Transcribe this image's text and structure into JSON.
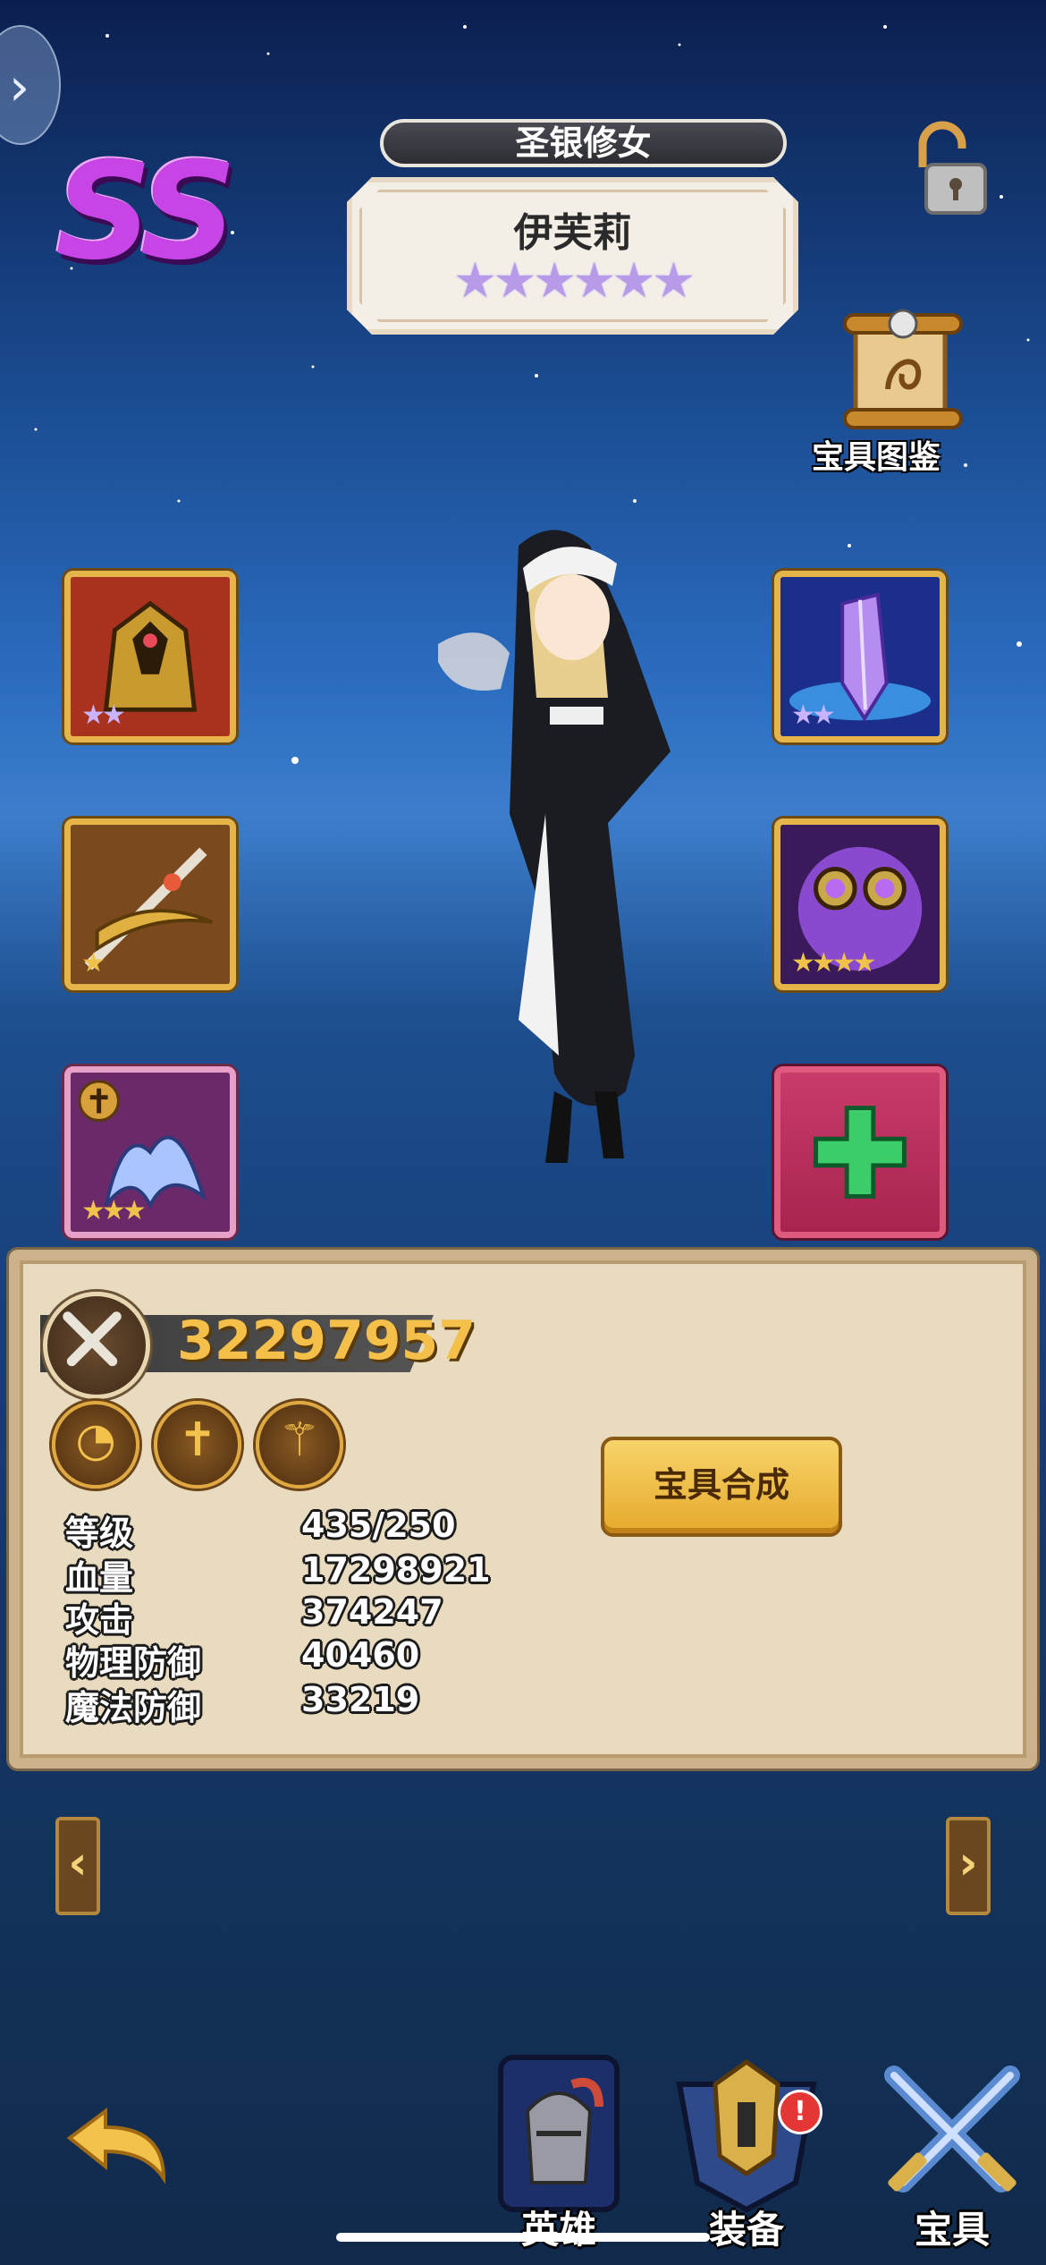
{
  "hero": {
    "grade": "SS",
    "class_title": "圣银修女",
    "name": "伊芙莉",
    "stars": "★★★★★★"
  },
  "artifact_codex": {
    "label": "宝具图鉴",
    "icon": "scroll-icon"
  },
  "lock": {
    "icon": "unlocked-padlock-icon"
  },
  "equipment": {
    "left": [
      {
        "name": "golden-armor",
        "stars": "★★"
      },
      {
        "name": "golden-sword",
        "stars": "★"
      },
      {
        "name": "holy-splash-relic",
        "stars": "★★★"
      }
    ],
    "right": [
      {
        "name": "purple-crystal",
        "stars": "★★"
      },
      {
        "name": "purple-orb-goggles",
        "stars": "★★★★"
      },
      {
        "name": "add-slot",
        "stars": ""
      }
    ]
  },
  "panel": {
    "power": "32297957",
    "skills": [
      "swirl-skill-icon",
      "cross-skill-icon",
      "staff-skill-icon"
    ],
    "synthesize_label": "宝具合成",
    "stats": [
      {
        "label": "等级",
        "value": "435/250"
      },
      {
        "label": "血量",
        "value": "17298921"
      },
      {
        "label": "攻击",
        "value": "374247"
      },
      {
        "label": "物理防御",
        "value": "40460"
      },
      {
        "label": "魔法防御",
        "value": "33219"
      }
    ]
  },
  "nav": {
    "prev": "‹",
    "next": "›",
    "tabs": [
      {
        "label": "英雄",
        "icon": "knight-helmet-icon"
      },
      {
        "label": "装备",
        "icon": "armor-crest-icon",
        "badge": "!"
      },
      {
        "label": "宝具",
        "icon": "crossed-swords-icon"
      }
    ]
  },
  "colors": {
    "grade": "#c744e6",
    "power": "#f4c04a",
    "panel": "#e8dbbf",
    "badge": "#e53636"
  }
}
